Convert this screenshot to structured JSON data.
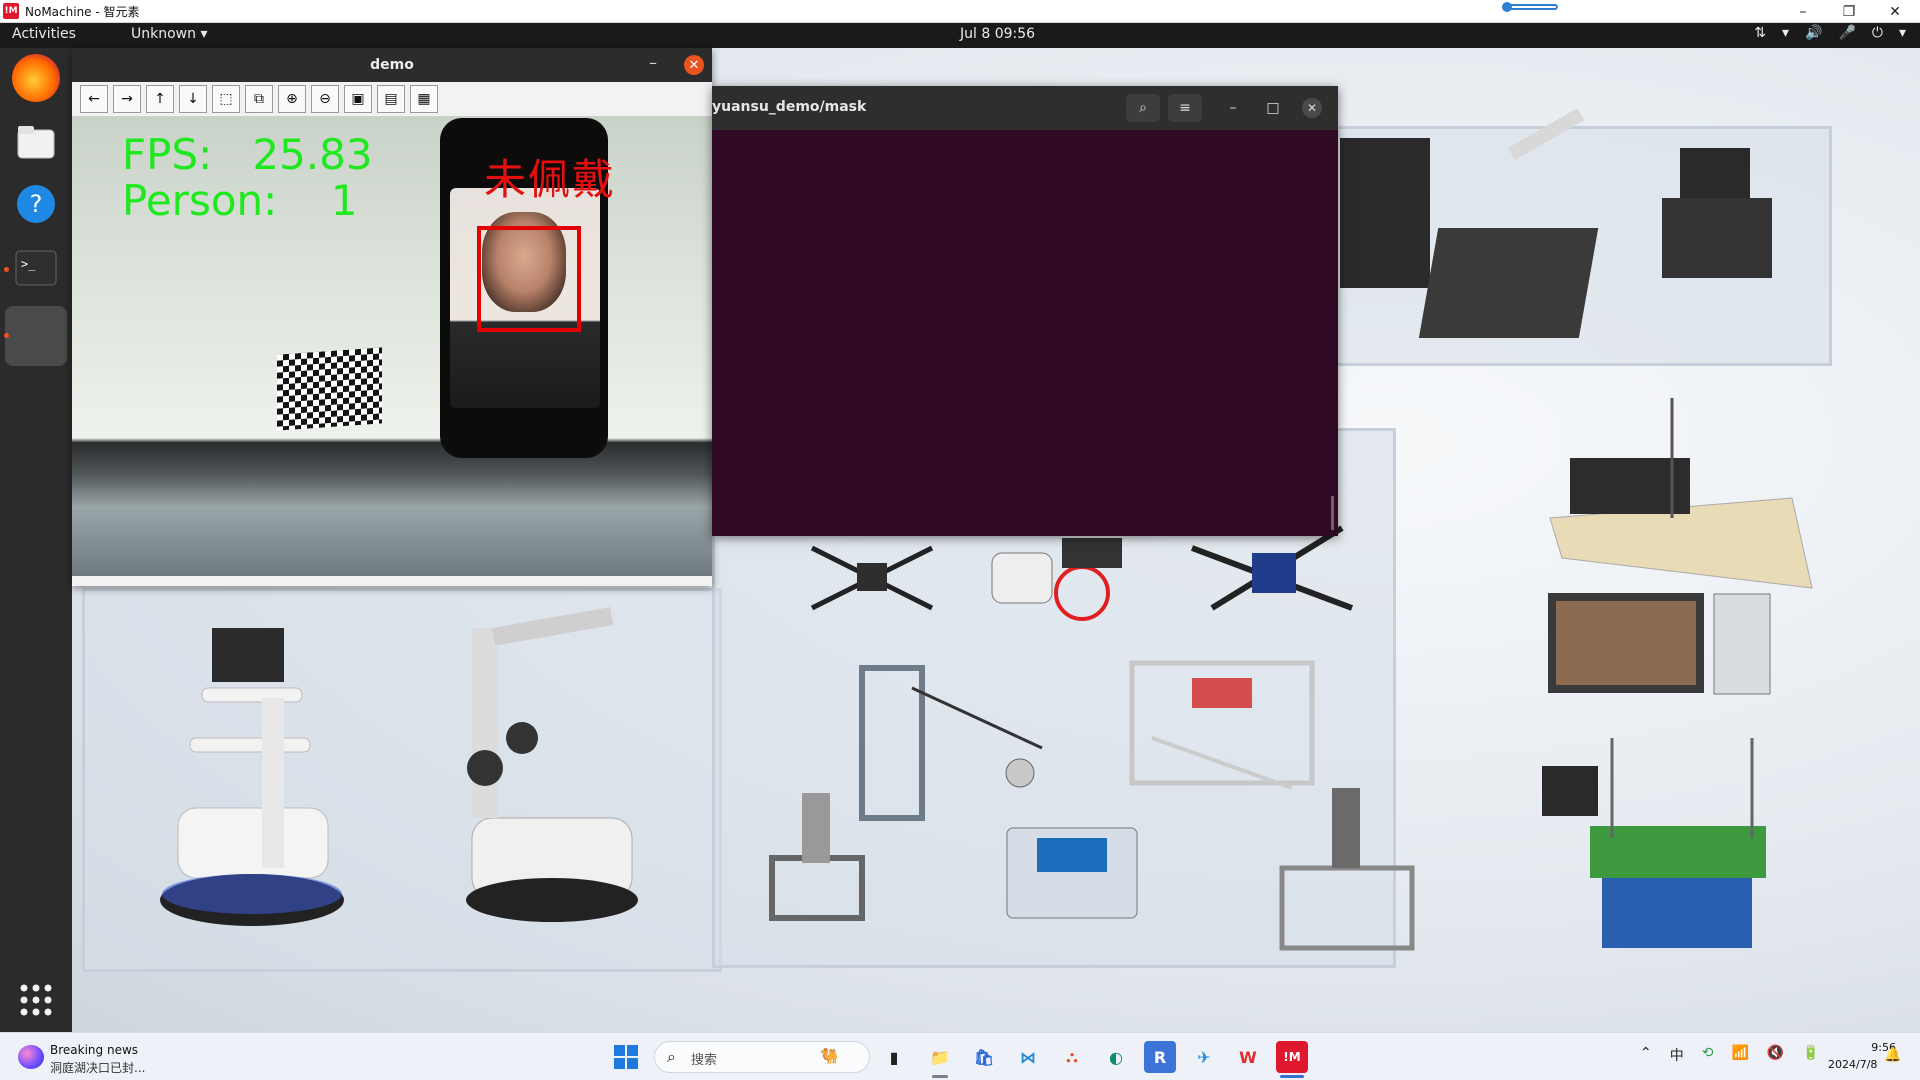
{
  "nomachine": {
    "logo": "!M",
    "title": "NoMachine - 智元素",
    "minimize": "–",
    "restore": "❐",
    "close": "✕"
  },
  "topbar": {
    "activities": "Activities",
    "app_menu": "Unknown ▾",
    "clock": "Jul 8  09:56",
    "tray": [
      "⇅",
      "▾",
      "🔊",
      "🎤",
      "⏻",
      "▾"
    ]
  },
  "dock": {
    "items": [
      "firefox",
      "files",
      "help",
      "terminal",
      "active-app"
    ],
    "apps_grid": "⋮⋮⋮"
  },
  "demo_window": {
    "title": "demo",
    "minimize": "–",
    "close": "✕",
    "toolbar": [
      "←",
      "→",
      "↑",
      "↓",
      "⬚",
      "⧉",
      "⊕",
      "⊖",
      "▣",
      "▤",
      "▦"
    ],
    "fps_label": "FPS:",
    "fps_value": "25.83",
    "person_label": "Person:",
    "person_value": "1",
    "mask_status": "未佩戴"
  },
  "terminal_window": {
    "title": "yuansu_demo/mask",
    "search": "⌕",
    "menu": "≡",
    "minimize": "–",
    "maximize": "□",
    "close": "✕"
  },
  "taskbar": {
    "news_title": "Breaking news",
    "news_sub": "洞庭湖决口已封...",
    "search_icon": "⌕",
    "search_placeholder": "搜索",
    "search_deco": "🐫",
    "apps": [
      "▮",
      "📁",
      "🛍",
      "⋈",
      "⛬",
      "◐",
      "R",
      "✈",
      "W",
      "!M"
    ],
    "tray": [
      "⌃",
      "中",
      "⟲",
      "📶",
      "🔇",
      "🔋"
    ],
    "time": "9:56",
    "date": "2024/7/8",
    "bell": "🔔"
  },
  "colors": {
    "ubuntu_orange": "#e95420",
    "terminal_bg": "#300a24",
    "fps_green": "#1fe81f",
    "detection_red": "#e30000"
  }
}
